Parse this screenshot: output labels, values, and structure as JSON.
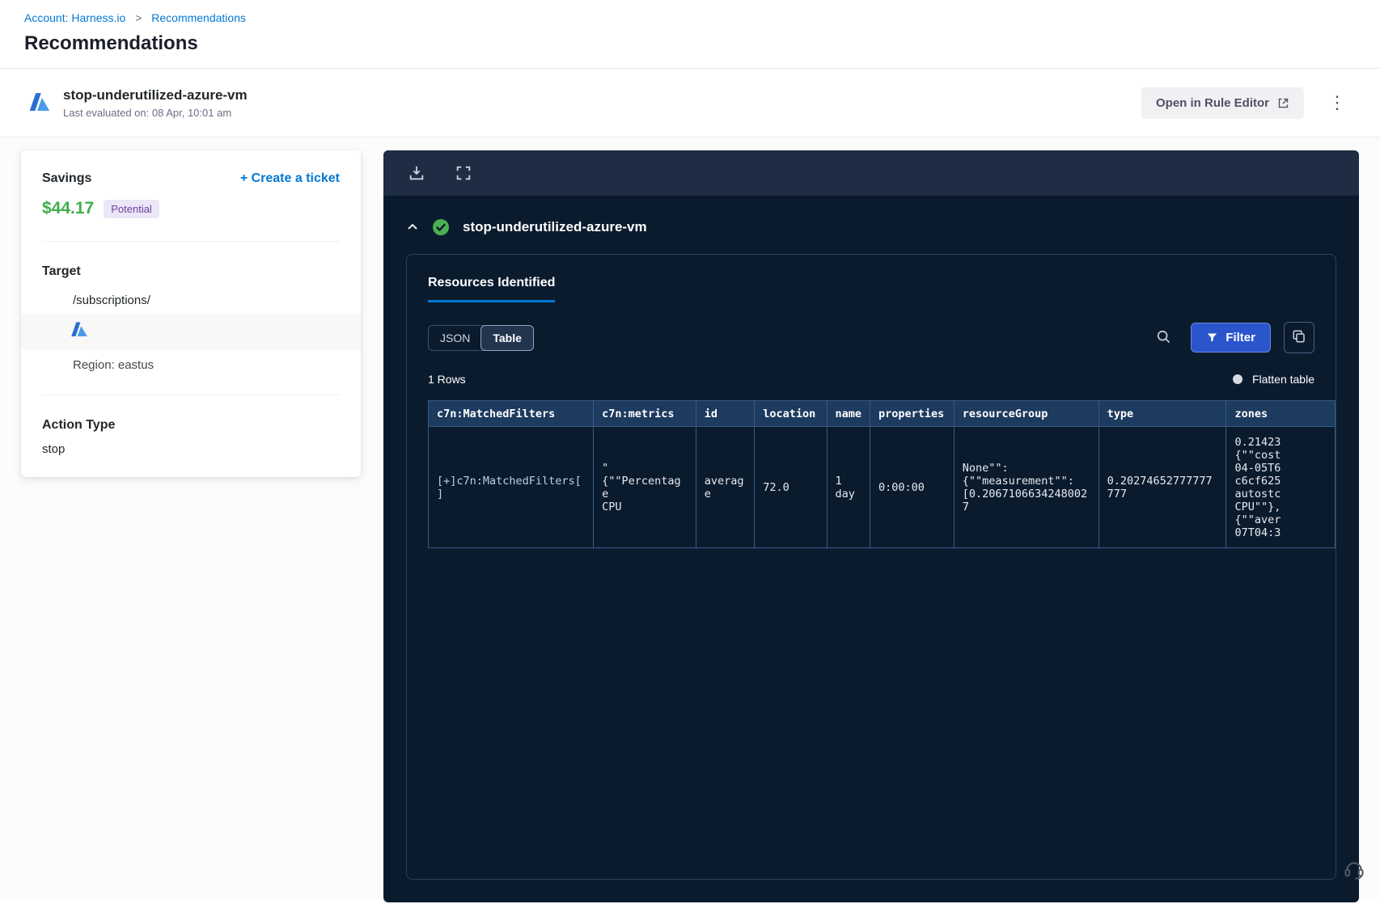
{
  "colors": {
    "accent_blue": "#0278d5",
    "savings_green": "#3fae49",
    "badge_purple_bg": "#ece7f7",
    "badge_purple_text": "#6b3fa0",
    "panel_bg": "#0b1b2e",
    "panel_toolbar_bg": "#1e2c44",
    "table_header_bg": "#1d3a5f",
    "filter_btn_blue": "#2b55cc",
    "check_green": "#4caf50"
  },
  "breadcrumb": {
    "account": "Account: Harness.io",
    "separator": ">",
    "current": "Recommendations"
  },
  "page": {
    "title": "Recommendations"
  },
  "header": {
    "title": "stop-underutilized-azure-vm",
    "last_evaluated": "Last evaluated on: 08 Apr, 10:01 am",
    "open_rule_editor": "Open in Rule Editor",
    "kebab": "⋮"
  },
  "savings_card": {
    "savings_label": "Savings",
    "create_ticket": "+ Create a ticket",
    "amount": "$44.17",
    "badge": "Potential",
    "target_label": "Target",
    "target_path": "/subscriptions/",
    "region": "Region: eastus",
    "action_type_label": "Action Type",
    "action_type_value": "stop"
  },
  "panel": {
    "section_title": "stop-underutilized-azure-vm",
    "tab_label": "Resources Identified",
    "seg_json": "JSON",
    "seg_table": "Table",
    "filter_label": "Filter",
    "rows_count": "1 Rows",
    "flatten_label": "Flatten table",
    "table": {
      "headers": [
        "c7n:MatchedFilters",
        "c7n:metrics",
        "id",
        "location",
        "name",
        "properties",
        "resourceGroup",
        "type",
        "zones"
      ],
      "cells": [
        "[+]c7n:MatchedFilters[]",
        "\"\n{\"\"Percentage\nCPU",
        "average",
        "72.0",
        "1\nday",
        "0:00:00",
        "None\"\":\n{\"\"measurement\"\":\n[0.20671066342480027",
        "0.20274652777777777",
        "0.21423\n{\"\"cost\n04-05T6\nc6cf625\nautostc\nCPU\"\"},\n{\"\"aver\n07T04:3"
      ]
    }
  }
}
